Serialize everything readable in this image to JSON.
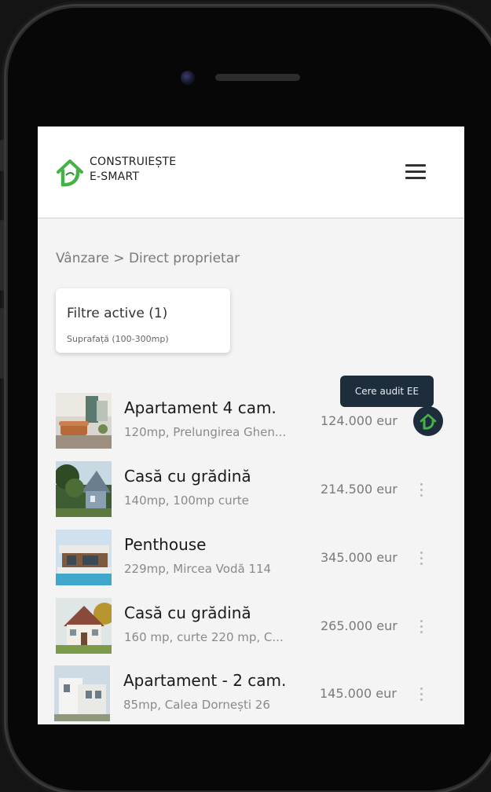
{
  "brand": {
    "line1": "CONSTRUIEȘTE",
    "line2": "E-SMART",
    "logo_icon": "house-leaf-logo",
    "accent": "#45b245"
  },
  "breadcrumb": "Vânzare > Direct proprietar",
  "filters": {
    "title": "Filtre active (1)",
    "detail": "Suprafață (100-300mp)"
  },
  "tooltip": "Cere audit EE",
  "listings": [
    {
      "title": "Apartament 4 cam.",
      "subtitle": "120mp, Prelungirea Ghen...",
      "price": "124.000 eur"
    },
    {
      "title": "Casă cu grădină",
      "subtitle": "140mp, 100mp curte",
      "price": "214.500 eur"
    },
    {
      "title": "Penthouse",
      "subtitle": "229mp, Mircea Vodă 114",
      "price": "345.000 eur"
    },
    {
      "title": "Casă cu grădină",
      "subtitle": "160 mp, curte 220 mp, C...",
      "price": "265.000 eur"
    },
    {
      "title": "Apartament - 2 cam.",
      "subtitle": "85mp, Calea Dornești 26",
      "price": "145.000 eur"
    }
  ],
  "colors": {
    "tooltip_bg": "#1d2d3c",
    "screen_bg": "#f4f4f4",
    "header_bg": "#ffffff"
  }
}
